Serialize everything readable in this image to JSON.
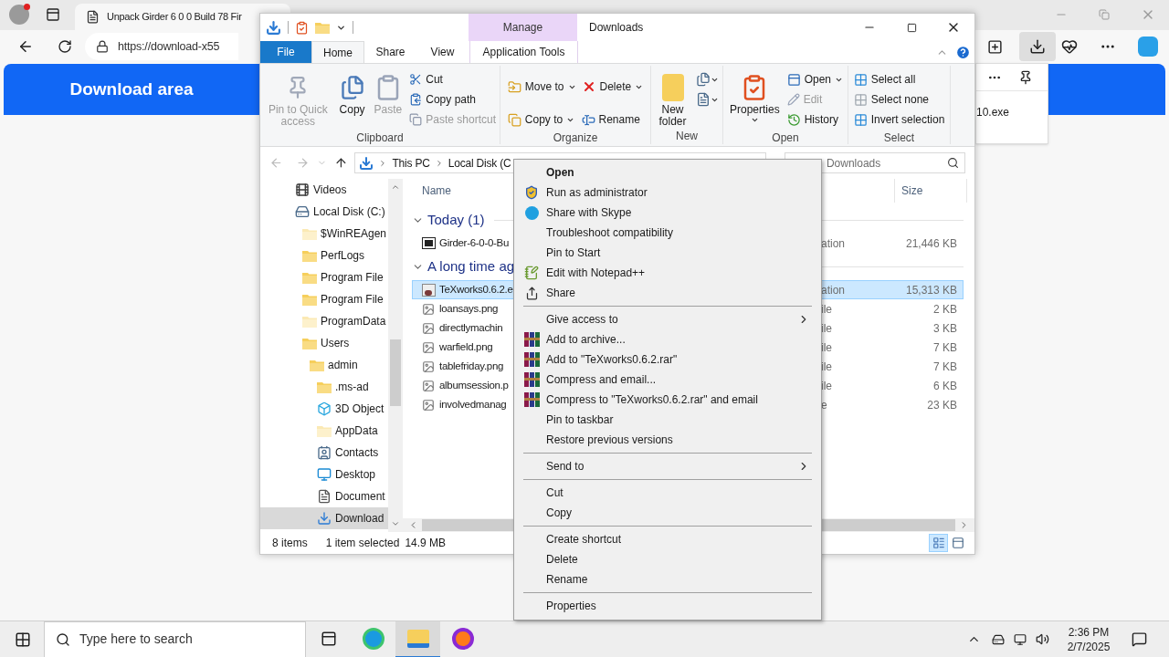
{
  "browser": {
    "tab_title": "Unpack Girder 6 0 0 Build 78 Fir",
    "address": "https://download-x55",
    "banner_title": "Download area",
    "download_item": "10.exe"
  },
  "explorer": {
    "title": "Downloads",
    "contextual_group": "Manage",
    "ribbon_tabs": [
      {
        "label": "File",
        "kind": "file",
        "selected": false
      },
      {
        "label": "Home",
        "kind": "tab",
        "selected": true
      },
      {
        "label": "Share",
        "kind": "tab",
        "selected": false
      },
      {
        "label": "View",
        "kind": "tab",
        "selected": false
      },
      {
        "label": "Application Tools",
        "kind": "contextual",
        "selected": false
      }
    ],
    "ribbon_groups": [
      {
        "label": "Clipboard",
        "buttons": [
          {
            "label": "Pin to Quick access",
            "kind": "large",
            "disabled": true,
            "dropdown": false
          },
          {
            "label": "Copy",
            "kind": "large",
            "disabled": false,
            "dropdown": false
          },
          {
            "label": "Paste",
            "kind": "large",
            "disabled": true,
            "dropdown": false
          },
          {
            "label": "Cut",
            "kind": "small",
            "disabled": false,
            "dropdown": false
          },
          {
            "label": "Copy path",
            "kind": "small",
            "disabled": false,
            "dropdown": false
          },
          {
            "label": "Paste shortcut",
            "kind": "small",
            "disabled": true,
            "dropdown": false
          }
        ]
      },
      {
        "label": "Organize",
        "buttons": [
          {
            "label": "Move to",
            "kind": "small",
            "disabled": false,
            "dropdown": true
          },
          {
            "label": "Copy to",
            "kind": "small",
            "disabled": false,
            "dropdown": true
          },
          {
            "label": "Delete",
            "kind": "small",
            "disabled": false,
            "dropdown": true
          },
          {
            "label": "Rename",
            "kind": "small",
            "disabled": false,
            "dropdown": false
          }
        ]
      },
      {
        "label": "New",
        "buttons": [
          {
            "label": "New folder",
            "kind": "large",
            "disabled": false,
            "dropdown": false
          },
          {
            "kind": "icon",
            "disabled": false,
            "dropdown": true
          },
          {
            "kind": "icon",
            "disabled": false,
            "dropdown": true
          }
        ]
      },
      {
        "label": "Open",
        "buttons": [
          {
            "label": "Properties",
            "kind": "large",
            "disabled": false,
            "dropdown": true
          },
          {
            "label": "Open",
            "kind": "small",
            "disabled": false,
            "dropdown": true
          },
          {
            "label": "Edit",
            "kind": "small",
            "disabled": true,
            "dropdown": false
          },
          {
            "label": "History",
            "kind": "small",
            "disabled": false,
            "dropdown": false
          }
        ]
      },
      {
        "label": "Select",
        "buttons": [
          {
            "label": "Select all",
            "kind": "small",
            "disabled": false,
            "dropdown": false
          },
          {
            "label": "Select none",
            "kind": "small",
            "disabled": false,
            "dropdown": false
          },
          {
            "label": "Invert selection",
            "kind": "small",
            "disabled": false,
            "dropdown": false
          }
        ]
      }
    ],
    "breadcrumbs": [
      "This PC",
      "Local Disk (C"
    ],
    "search_placeholder": "Downloads",
    "nav_tree": [
      {
        "label": "Videos",
        "kind": "videos",
        "selected": false
      },
      {
        "label": "Local Disk (C:)",
        "kind": "drive",
        "selected": false,
        "children": [
          {
            "label": "$WinREAgen",
            "kind": "pale",
            "selected": false
          },
          {
            "label": "PerfLogs",
            "kind": "folder",
            "selected": false
          },
          {
            "label": "Program File",
            "kind": "folder",
            "selected": false
          },
          {
            "label": "Program File",
            "kind": "folder",
            "selected": false
          },
          {
            "label": "ProgramData",
            "kind": "pale",
            "selected": false
          },
          {
            "label": "Users",
            "kind": "folder",
            "selected": false,
            "children": [
              {
                "label": "admin",
                "kind": "folder",
                "selected": false,
                "children": [
                  {
                    "label": ".ms-ad",
                    "kind": "folder",
                    "selected": false
                  },
                  {
                    "label": "3D Object",
                    "kind": "objects",
                    "selected": false
                  },
                  {
                    "label": "AppData",
                    "kind": "pale",
                    "selected": false
                  },
                  {
                    "label": "Contacts",
                    "kind": "contacts",
                    "selected": false
                  },
                  {
                    "label": "Desktop",
                    "kind": "desktop",
                    "selected": false
                  },
                  {
                    "label": "Document",
                    "kind": "documents",
                    "selected": false
                  },
                  {
                    "label": "Download",
                    "kind": "downloads",
                    "selected": true
                  }
                ]
              }
            ]
          }
        ]
      }
    ],
    "columns": [
      "Name",
      "Size"
    ],
    "groups": [
      {
        "label": "Today (1)",
        "expanded": true,
        "files": [
          {
            "name": "Girder-6-0-0-Bu",
            "kind": "archive",
            "type": "ation",
            "size": "21,446 KB",
            "selected": false
          }
        ]
      },
      {
        "label": "A long time ag",
        "expanded": true,
        "files": [
          {
            "name": "TeXworks0.6.2.e",
            "kind": "application",
            "type": "ation",
            "size": "15,313 KB",
            "selected": true
          },
          {
            "name": "loansays.png",
            "kind": "image",
            "type": "ile",
            "size": "2 KB",
            "selected": false
          },
          {
            "name": "directlymachin",
            "kind": "image",
            "type": "ile",
            "size": "3 KB",
            "selected": false
          },
          {
            "name": "warfield.png",
            "kind": "image",
            "type": "ile",
            "size": "7 KB",
            "selected": false
          },
          {
            "name": "tablefriday.png",
            "kind": "image",
            "type": "ile",
            "size": "7 KB",
            "selected": false
          },
          {
            "name": "albumsession.p",
            "kind": "image",
            "type": "ile",
            "size": "6 KB",
            "selected": false
          },
          {
            "name": "involvedmanag",
            "kind": "image",
            "type": "e",
            "size": "23 KB",
            "selected": false
          }
        ]
      }
    ],
    "status": {
      "count": "8 items",
      "selection": "1 item selected",
      "size": "14.9 MB"
    },
    "view_buttons": [
      {
        "kind": "details",
        "selected": true
      },
      {
        "kind": "preview",
        "selected": false
      }
    ]
  },
  "context_menu": [
    {
      "label": "Open",
      "kind": "default"
    },
    {
      "label": "Run as administrator",
      "kind": "item"
    },
    {
      "label": "Share with Skype",
      "kind": "item"
    },
    {
      "label": "Troubleshoot compatibility",
      "kind": "item"
    },
    {
      "label": "Pin to Start",
      "kind": "item"
    },
    {
      "label": "Edit with Notepad++",
      "kind": "item"
    },
    {
      "label": "Share",
      "kind": "item"
    },
    {
      "kind": "separator"
    },
    {
      "label": "Give access to",
      "kind": "submenu"
    },
    {
      "label": "Add to archive...",
      "kind": "item"
    },
    {
      "label": "Add to \"TeXworks0.6.2.rar\"",
      "kind": "item"
    },
    {
      "label": "Compress and email...",
      "kind": "item"
    },
    {
      "label": "Compress to \"TeXworks0.6.2.rar\" and email",
      "kind": "item"
    },
    {
      "label": "Pin to taskbar",
      "kind": "item"
    },
    {
      "label": "Restore previous versions",
      "kind": "item"
    },
    {
      "kind": "separator"
    },
    {
      "label": "Send to",
      "kind": "submenu"
    },
    {
      "kind": "separator"
    },
    {
      "label": "Cut",
      "kind": "item"
    },
    {
      "label": "Copy",
      "kind": "item"
    },
    {
      "kind": "separator"
    },
    {
      "label": "Create shortcut",
      "kind": "item"
    },
    {
      "label": "Delete",
      "kind": "item"
    },
    {
      "label": "Rename",
      "kind": "item"
    },
    {
      "kind": "separator"
    },
    {
      "label": "Properties",
      "kind": "item"
    }
  ],
  "taskbar": {
    "search_placeholder": "Type here to search",
    "apps": [
      {
        "kind": "taskview",
        "selected": false
      },
      {
        "kind": "edge",
        "selected": false
      },
      {
        "kind": "explorer",
        "selected": true
      },
      {
        "kind": "firefox",
        "selected": false
      }
    ],
    "time": "2:36 PM",
    "date": "2/7/2025"
  }
}
